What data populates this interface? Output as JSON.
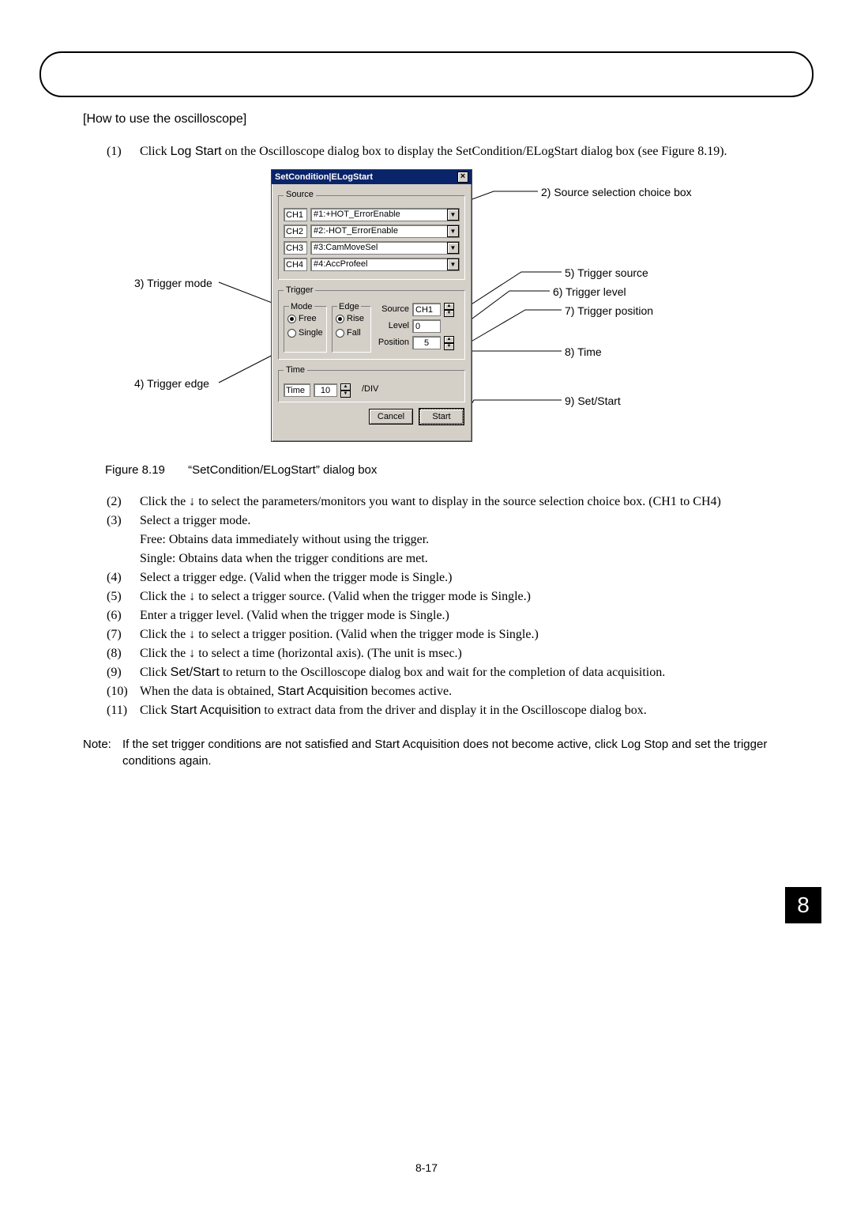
{
  "section_title": "[How to use the oscilloscope]",
  "intro": {
    "num": "(1)",
    "pre": "Click ",
    "btn": "Log Start",
    "mid": " on the  Oscilloscope  dialog box to display the  SetCondition/ELogStart  dialog box (see Figure 8.19)."
  },
  "dialog": {
    "title": "SetCondition|ELogStart",
    "source_legend": "Source",
    "ch": [
      "CH1",
      "CH2",
      "CH3",
      "CH4"
    ],
    "chval": [
      "#1:+HOT_ErrorEnable",
      "#2:-HOT_ErrorEnable",
      "#3:CamMoveSel",
      "#4:AccProfeel"
    ],
    "trigger_legend": "Trigger",
    "mode_legend": "Mode",
    "mode_free": "Free",
    "mode_single": "Single",
    "edge_legend": "Edge",
    "edge_rise": "Rise",
    "edge_fall": "Fall",
    "src_label": "Source",
    "src_val": "CH1",
    "lvl_label": "Level",
    "lvl_val": "0",
    "pos_label": "Position",
    "pos_val": "5",
    "time_legend": "Time",
    "time_label": "Time",
    "time_val": "10",
    "time_div": "/DIV",
    "cancel": "Cancel",
    "start": "Start"
  },
  "callouts": {
    "c2": "2) Source selection choice box",
    "c3": "3) Trigger mode",
    "c4": "4) Trigger edge",
    "c5": "5) Trigger source",
    "c6": "6) Trigger level",
    "c7": "7) Trigger position",
    "c8": "8) Time",
    "c9": "9) Set/Start"
  },
  "figcap_a": "Figure 8.19",
  "figcap_b": "“SetCondition/ELogStart” dialog box",
  "steps": [
    {
      "n": "(2)",
      "t": "Click the ↓ to select the parameters/monitors you want to display in the   source selection choice box. (CH1 to CH4)"
    },
    {
      "n": "(3)",
      "t": "Select a trigger mode.\nFree: Obtains data immediately without using the trigger.\nSingle: Obtains data when the trigger conditions are met."
    },
    {
      "n": "(4)",
      "t": "Select a trigger edge. (Valid when the trigger mode is Single.)"
    },
    {
      "n": "(5)",
      "t": "Click the ↓ to select a trigger source. (Valid when the trigger mode is Single.)"
    },
    {
      "n": "(6)",
      "t": "Enter a trigger level. (Valid when the trigger mode is Single.)"
    },
    {
      "n": "(7)",
      "t": "Click the ↓ to select a trigger position. (Valid when the trigger mode is Single.)"
    },
    {
      "n": "(8)",
      "t": "Click the ↓ to select a time (horizontal axis). (The unit is msec.)"
    },
    {
      "n": "(9)",
      "pre": "Click  ",
      "b": "Set/Start",
      "post": "  to return to the  Oscilloscope  dialog box and wait for the completion of data acquisition."
    },
    {
      "n": "(10)",
      "pre": "When the data is obtained,  ",
      "b": "Start Acquisition",
      "post": "  becomes active."
    },
    {
      "n": "(11)",
      "pre": "Click  ",
      "b": "Start Acquisition",
      "post": "  to extract data from the driver and display it in the  Oscilloscope  dialog box."
    }
  ],
  "note": {
    "label": "Note:",
    "pre": "If the set trigger conditions are not satisfied and  ",
    "b1": "Start Acquisition",
    "mid": "  does not become active, click  ",
    "b2": "Log Stop",
    "post": "  and set the trigger conditions again."
  },
  "chapter": "8",
  "pgnum": "8-17"
}
